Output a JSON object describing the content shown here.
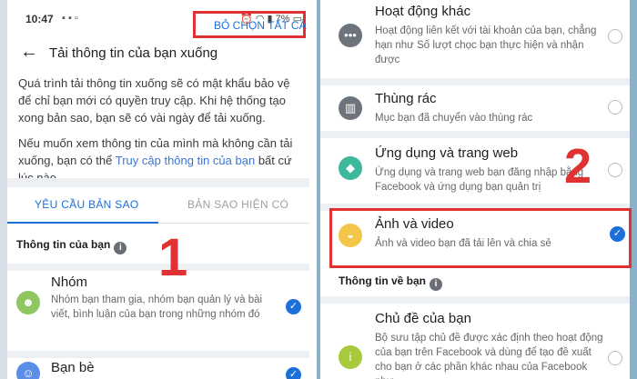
{
  "status_bar": {
    "time": "10:47",
    "battery": "7%"
  },
  "header": {
    "back": "←",
    "title": "Tải thông tin của bạn xuống"
  },
  "intro": {
    "p1": "Quá trình tải thông tin xuống sẽ có mật khẩu bảo vệ để chỉ bạn mới có quyền truy cập. Khi hệ thống tạo xong bản sao, bạn sẽ có vài ngày để tải xuống.",
    "p2_before": "Nếu muốn xem thông tin của mình mà không cần tải xuống, bạn có thể ",
    "p2_link": "Truy cập thông tin của bạn",
    "p2_after": " bất cứ lúc nào."
  },
  "tabs": {
    "active": "YÊU CẦU BẢN SAO",
    "inactive": "BẢN SAO HIỆN CÓ"
  },
  "section": {
    "label": "Thông tin của bạn",
    "deselect_all": "BỎ CHỌN TẤT CẢ"
  },
  "left_items": [
    {
      "title": "Nhóm",
      "desc": "Nhóm bạn tham gia, nhóm bạn quản lý và bài viết, bình luận của bạn trong những nhóm đó",
      "checked": true
    },
    {
      "title": "Bạn bè",
      "desc": "",
      "checked": true
    }
  ],
  "right_items": [
    {
      "title": "Hoạt động khác",
      "desc": "Hoạt động liên kết với tài khoản của bạn, chẳng hạn như Số lượt chọc bạn thực hiện và nhận được",
      "checked": false
    },
    {
      "title": "Thùng rác",
      "desc": "Mục bạn đã chuyển vào thùng rác",
      "checked": false
    },
    {
      "title": "Ứng dụng và trang web",
      "desc": "Ứng dụng và trang web bạn đăng nhập bằng Facebook và ứng dụng bạn quản trị",
      "checked": false
    },
    {
      "title": "Ảnh và video",
      "desc": "Ảnh và video bạn đã tải lên và chia sẻ",
      "checked": true
    }
  ],
  "right_section": {
    "label": "Thông tin về bạn"
  },
  "right_item_bottom": {
    "title": "Chủ đề của bạn",
    "desc": "Bộ sưu tập chủ đề được xác định theo hoạt động của bạn trên Facebook và dùng để tạo đề xuất cho bạn ở các phần khác nhau của Facebook như...",
    "checked": false
  },
  "annotations": {
    "step1": "1",
    "step2": "2"
  },
  "colors": {
    "accent": "#1b6fd8",
    "highlight": "#e03232"
  }
}
